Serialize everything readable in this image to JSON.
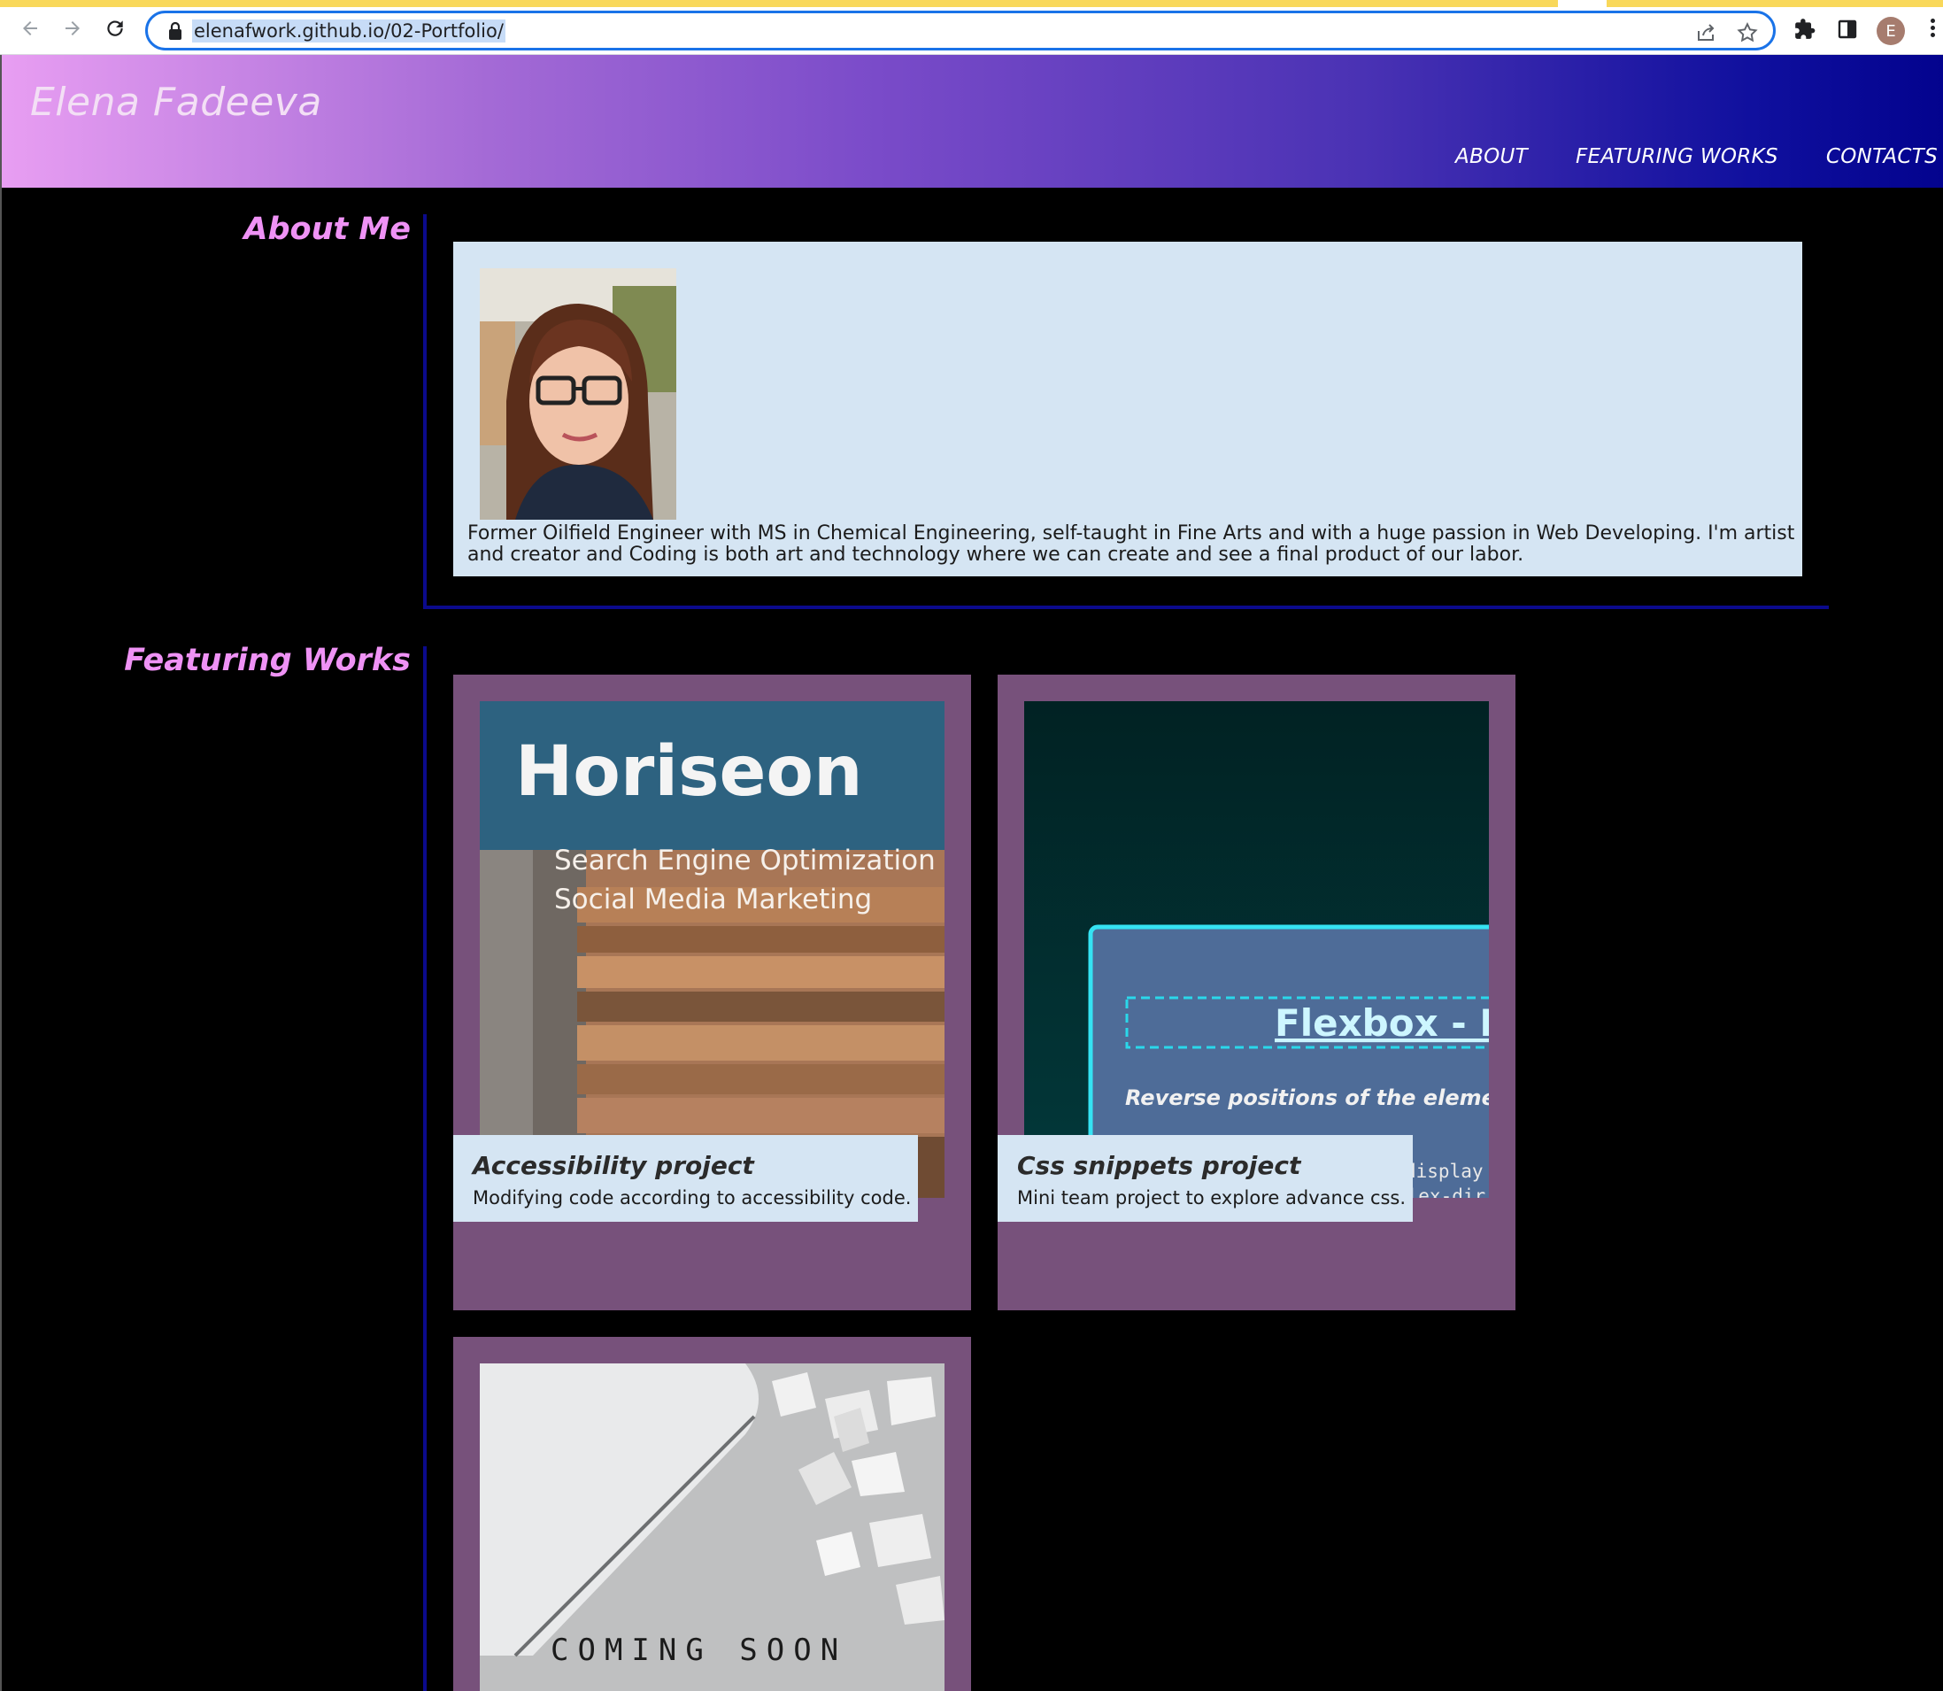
{
  "browser": {
    "url": "elenafwork.github.io/02-Portfolio/",
    "profile_initial": "E",
    "icons": [
      "back-arrow-icon",
      "forward-arrow-icon",
      "reload-icon",
      "lock-icon",
      "share-icon",
      "bookmark-star-icon",
      "extensions-puzzle-icon",
      "side-panel-icon",
      "menu-kebab-icon"
    ]
  },
  "header": {
    "site_title": "Elena Fadeeva",
    "nav": [
      {
        "label": "ABOUT"
      },
      {
        "label": "FEATURING WORKS"
      },
      {
        "label": "CONTACTS"
      }
    ]
  },
  "about": {
    "heading": "About Me",
    "bio": "Former Oilfield Engineer with MS in Chemical Engineering, self-taught in Fine Arts and with a huge passion in Web Developing. I'm artist and creator and Coding is both art and technology where we can create and see a final product of our labor."
  },
  "works": {
    "heading": "Featuring Works",
    "cards": [
      {
        "title": "Accessibility project",
        "description": "Modifying code according to accessibility code.",
        "thumb_heading": "Horiseon",
        "thumb_lines": [
          "Search Engine Optimization",
          "Social Media Marketing"
        ]
      },
      {
        "title": "Css snippets project",
        "description": "Mini team project to explore advance css.",
        "thumb_heading": "Flexbox - Re",
        "thumb_subtitle": "Reverse positions of the elements",
        "thumb_code": [
          "display",
          "flex-dir"
        ]
      },
      {
        "title": "",
        "description": "",
        "thumb_text": "COMING SOON"
      }
    ]
  },
  "colors": {
    "section_heading": "#ef92f5",
    "card_background": "#77517b",
    "about_box": "#d5e5f3",
    "divider": "#0b0a8c",
    "header_gradient_start": "#e89ef2",
    "header_gradient_end": "#03038e"
  }
}
